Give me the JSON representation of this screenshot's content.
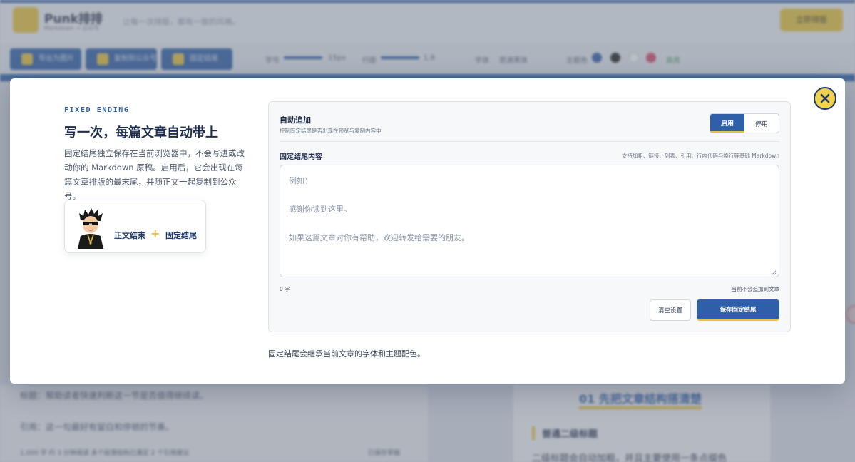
{
  "background": {
    "brand": "Punk排排",
    "brand_sub": "Markdown → 公众号",
    "tagline": "让每一次排版，都有一致的风格。",
    "launch_button": "立即排版",
    "toolbar_buttons": [
      "导出为图片",
      "复制到公众号",
      "固定结尾"
    ],
    "font_size_label": "字号",
    "font_size_value": "15px",
    "line_height_label": "行距",
    "line_height_value": "1.8",
    "font_label": "字体",
    "font_value": "思源黑体",
    "theme_label": "主题色",
    "style_label": "高亮",
    "lines": [
      "标题：帮助读者快速判断这一节是否值得继续读。",
      "引用：这一句最好有留白和停顿的节奏。",
      "1,000 字   约 3 分钟阅读   多个段落结构已满足 2 个引用建议",
      "已保存草稿"
    ],
    "preview_h1": "01 先把文章结构搭清楚",
    "preview_h2": "普通二级标题",
    "preview_para": "二级标题会自动加粗，并且主要使用一条点缀色"
  },
  "modal": {
    "eyebrow": "FIXED ENDING",
    "title": "写一次，每篇文章自动带上",
    "description": "固定结尾独立保存在当前浏览器中，不会写进或改动你的 Markdown 原稿。启用后，它会出现在每篇文章排版的最末尾，并随正文一起复制到公众号。",
    "preview": {
      "label_a": "正文结束",
      "plus": "+",
      "label_b": "固定结尾"
    },
    "auto_append": {
      "label": "自动追加",
      "hint": "控制固定结尾是否出现在预览与复制内容中",
      "on": "启用",
      "off": "停用",
      "selected": "启用"
    },
    "content": {
      "label": "固定结尾内容",
      "hint": "支持加粗、链接、列表、引用、行内代码与换行等基础 Markdown",
      "value": "",
      "placeholder": "例如：\n\n感谢你读到这里。\n\n如果这篇文章对你有帮助，欢迎转发给需要的朋友。",
      "count": "0 字",
      "status": "当前不会追加到文章"
    },
    "clear_button": "清空设置",
    "save_button": "保存固定结尾",
    "footnote": "固定结尾会继承当前文章的字体和主题配色。"
  },
  "colors": {
    "accent_blue": "#2f5fa8",
    "accent_yellow": "#e8c43c",
    "text_dark": "#1f2d4d"
  },
  "icons": [
    "close-icon",
    "avatar-icon",
    "resize-handle-icon"
  ]
}
